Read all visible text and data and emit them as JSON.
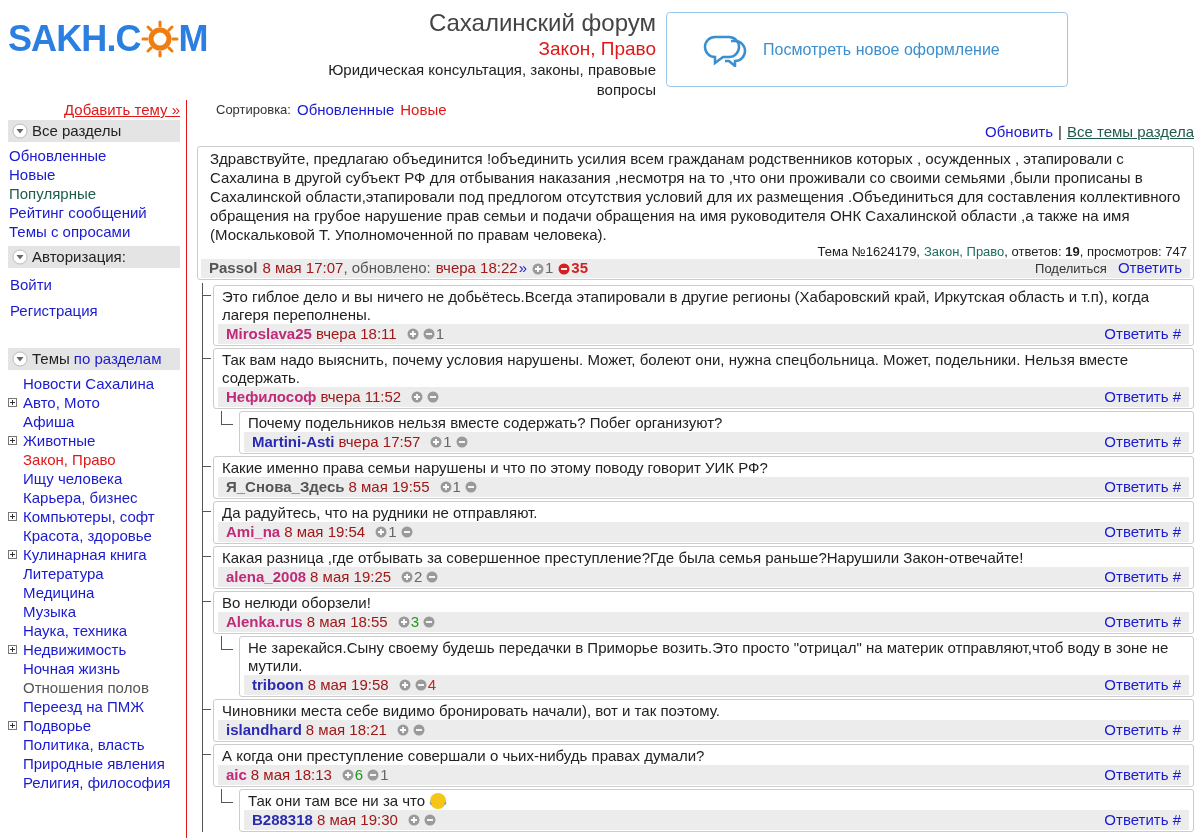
{
  "logo": {
    "before": "SAKH.C",
    "after": "M"
  },
  "header": {
    "title": "Сахалинский форум",
    "section": "Закон, Право",
    "description": "Юридическая консультация, законы, правовые вопросы"
  },
  "new_design": {
    "label": "Посмотреть новое оформление"
  },
  "sidebar": {
    "add_topic": "Добавить тему »",
    "all_sections": {
      "title": "Все разделы",
      "expanded": true,
      "items": [
        {
          "label": "Обновленные",
          "color": "#1a1ad0"
        },
        {
          "label": "Новые",
          "color": "#1a1ad0"
        },
        {
          "label": "Популярные",
          "color": "#1f5c4c"
        },
        {
          "label": "Рейтинг сообщений",
          "color": "#1a1ad0"
        },
        {
          "label": "Темы с опросами",
          "color": "#1a1ad0"
        }
      ]
    },
    "auth": {
      "title": "Авторизация:",
      "expanded": true,
      "items": [
        "Войти",
        "Регистрация"
      ]
    },
    "topics": {
      "title": "Темы",
      "title_link": "по разделам",
      "expanded": true,
      "items": [
        {
          "label": "Новости Сахалина",
          "expandable": false,
          "selected": false
        },
        {
          "label": "Авто, Мото",
          "expandable": true,
          "selected": false
        },
        {
          "label": "Афиша",
          "expandable": false,
          "selected": false
        },
        {
          "label": "Животные",
          "expandable": true,
          "selected": false
        },
        {
          "label": "Закон, Право",
          "expandable": false,
          "selected": true
        },
        {
          "label": "Ищу человека",
          "expandable": false,
          "selected": false
        },
        {
          "label": "Карьера, бизнес",
          "expandable": false,
          "selected": false
        },
        {
          "label": "Компьютеры, софт",
          "expandable": true,
          "selected": false
        },
        {
          "label": "Красота, здоровье",
          "expandable": false,
          "selected": false
        },
        {
          "label": "Кулинарная книга",
          "expandable": true,
          "selected": false
        },
        {
          "label": "Литература",
          "expandable": false,
          "selected": false
        },
        {
          "label": "Медицина",
          "expandable": false,
          "selected": false
        },
        {
          "label": "Музыка",
          "expandable": false,
          "selected": false
        },
        {
          "label": "Наука, техника",
          "expandable": false,
          "selected": false
        },
        {
          "label": "Недвижимость",
          "expandable": true,
          "selected": false
        },
        {
          "label": "Ночная жизнь",
          "expandable": false,
          "selected": false
        },
        {
          "label": "Отношения полов",
          "expandable": false,
          "selected": false,
          "visited": true
        },
        {
          "label": "Переезд на ПМЖ",
          "expandable": false,
          "selected": false
        },
        {
          "label": "Подворье",
          "expandable": true,
          "selected": false
        },
        {
          "label": "Политика, власть",
          "expandable": false,
          "selected": false
        },
        {
          "label": "Природные явления",
          "expandable": false,
          "selected": false
        },
        {
          "label": "Религия, философия",
          "expandable": false,
          "selected": false
        }
      ]
    }
  },
  "sort": {
    "label": "Сортировка:",
    "options": [
      {
        "label": "Обновленные",
        "selected": false
      },
      {
        "label": "Новые",
        "selected": true
      }
    ]
  },
  "top_links": {
    "refresh": "Обновить",
    "separator": "|",
    "all_topics": "Все темы раздела"
  },
  "topic": {
    "text": "Здравствуйте, предлагаю объединится !объединить усилия всем гражданам родственников которых , осужденных , этапировали с Сахалина в другой субъект РФ для отбывания наказания ,несмотря на то ,что они проживали со своими семьями ,были прописаны в Сахалинской области,этапировали под предлогом отсутствия условий для их размещения .Объединиться для составления коллективного обращения на грубое нарушение прав семьи и подачи обращения на имя руководителя ОНК Сахалинской области ,а также на имя (Москальковой Т. Уполномоченной по правам человека).",
    "number": "Тема №1624179,",
    "section": "Закон, Право",
    "stats": ", ответов: **19**, просмотров: 747",
    "author": "Passol",
    "color": "#555555",
    "time": "8 мая 17:07",
    "updated_label": ", обновлено:",
    "updated": "вчера 18:22",
    "more": "»",
    "plus": {
      "count": "1",
      "highlight": false
    },
    "minus": {
      "count": "35",
      "highlight": true
    },
    "share": "Поделиться",
    "reply": "Ответить"
  },
  "comments": [
    {
      "text": "Это гиблое дело и вы ничего не добьётесь.Всегда этапировали в другие регионы (Хабаровский край, Иркутская область и т.п), когда лагеря переполнены.",
      "author": "Miroslava25",
      "color": "#c02a78",
      "time": "вчера 18:11",
      "minus": {
        "count": "1",
        "highlight": false
      },
      "reply": "Ответить #"
    },
    {
      "text": "Так вам надо выяснить, почему условия нарушены. Может, болеют они, нужна спецбольница. Может, подельники. Нельзя вместе содержать.",
      "author": "Нефилософ",
      "color": "#c02a78",
      "time": "вчера 11:52",
      "reply": "Ответить #",
      "children": [
        {
          "text": "Почему подельников нельзя вместе содержать? Побег организуют?",
          "author": "Martini-Asti",
          "color": "#2a2ab0",
          "time": "вчера 17:57",
          "plus": {
            "count": "1",
            "highlight": false
          },
          "reply": "Ответить #"
        }
      ]
    },
    {
      "text": "Какие именно права семьи нарушены и что по этому поводу говорит УИК РФ?",
      "author": "Я_Снова_Здесь",
      "color": "#555555",
      "time": "8 мая 19:55",
      "plus": {
        "count": "1",
        "highlight": false
      },
      "reply": "Ответить #"
    },
    {
      "text": "Да радуйтесь, что на рудники не отправляют.",
      "author": "Ami_na",
      "color": "#c02a78",
      "time": "8 мая 19:54",
      "plus": {
        "count": "1",
        "highlight": false
      },
      "reply": "Ответить #"
    },
    {
      "text": "Какая разница ,где отбывать за совершенное преступление?Где была семья раньше?Нарушили Закон-отвечайте!",
      "author": "alena_2008",
      "color": "#c02a78",
      "time": "8 мая 19:25",
      "plus": {
        "count": "2",
        "highlight": false
      },
      "reply": "Ответить #"
    },
    {
      "text": "Во нелюди оборзели!",
      "author": "Alenka.rus",
      "color": "#c02a78",
      "time": "8 мая 18:55",
      "plus": {
        "count": "3",
        "highlight": true
      },
      "reply": "Ответить #",
      "children": [
        {
          "text": "Не зарекайся.Сыну своему будешь передачки в Приморье возить.Это просто \"отрицал\" на материк отправляют,чтоб воду в зоне не мутили.",
          "author": "triboon",
          "color": "#2a2ab0",
          "time": "8 мая 19:58",
          "minus": {
            "count": "4",
            "highlight": true
          },
          "reply": "Ответить #"
        }
      ]
    },
    {
      "text": "Чиновники места себе видимо бронировать начали), вот и так поэтому.",
      "author": "islandhard",
      "color": "#2a2ab0",
      "time": "8 мая 18:21",
      "reply": "Ответить #"
    },
    {
      "text": "А когда они преступление совершали о чьих-нибудь правах думали?",
      "author": "aic",
      "color": "#c02a78",
      "time": "8 мая 18:13",
      "plus": {
        "count": "6",
        "highlight": true
      },
      "minus": {
        "count": "1",
        "highlight": false
      },
      "reply": "Ответить #",
      "children": [
        {
          "text": "Так они там все ни за что",
          "emoji": true,
          "author": "B288318",
          "color": "#2a2ab0",
          "time": "8 мая 19:30",
          "reply": "Ответить #"
        }
      ]
    }
  ]
}
